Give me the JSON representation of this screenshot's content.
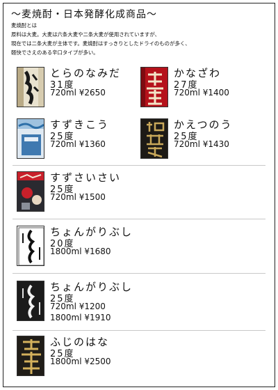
{
  "title": "〜麦焼酎・日本発酵化成商品〜",
  "intro": [
    "麦焼酎とは",
    "原料は大麦。大麦は六条大麦や二条大麦が使用されていますが、",
    "現在では二条大麦が主体です。麦焼酎はすっきりとしたドライのものが多く、",
    "軽快でさえのある辛口タイプが多い。"
  ],
  "products": [
    {
      "name": "とらのなみだ",
      "degree": "31度",
      "prices": [
        "720ml ¥2650"
      ],
      "label_text": "虎の泪"
    },
    {
      "name": "かなざわ",
      "degree": "27度",
      "prices": [
        "720ml ¥1400"
      ],
      "label_text": "金澤"
    },
    {
      "name": "すずきこう",
      "degree": "25度",
      "prices": [
        "720ml ¥1360"
      ],
      "label_text": ""
    },
    {
      "name": "かえつのう",
      "degree": "25度",
      "prices": [
        "720ml ¥1430"
      ],
      "label_text": "加越能"
    },
    {
      "name": "すずさいさい",
      "degree": "25度",
      "prices": [
        "720ml ¥1500"
      ],
      "label_text": ""
    },
    {
      "name": "ちょんがりぶし",
      "degree": "20度",
      "prices": [
        "1800ml ¥1680"
      ],
      "label_text": "ちょんがりぶし"
    },
    {
      "name": "ちょんがりぶし",
      "degree": "25度",
      "prices": [
        "720ml ¥1200",
        "1800ml ¥1910"
      ],
      "label_text": "ちょんがり"
    },
    {
      "name": "ふじのはな",
      "degree": "25度",
      "prices": [
        "1800ml ¥2500"
      ],
      "label_text": "富士の華"
    }
  ],
  "colors": {
    "text": "#111111",
    "frame": "#222222",
    "separator": "#c8c8c8"
  }
}
